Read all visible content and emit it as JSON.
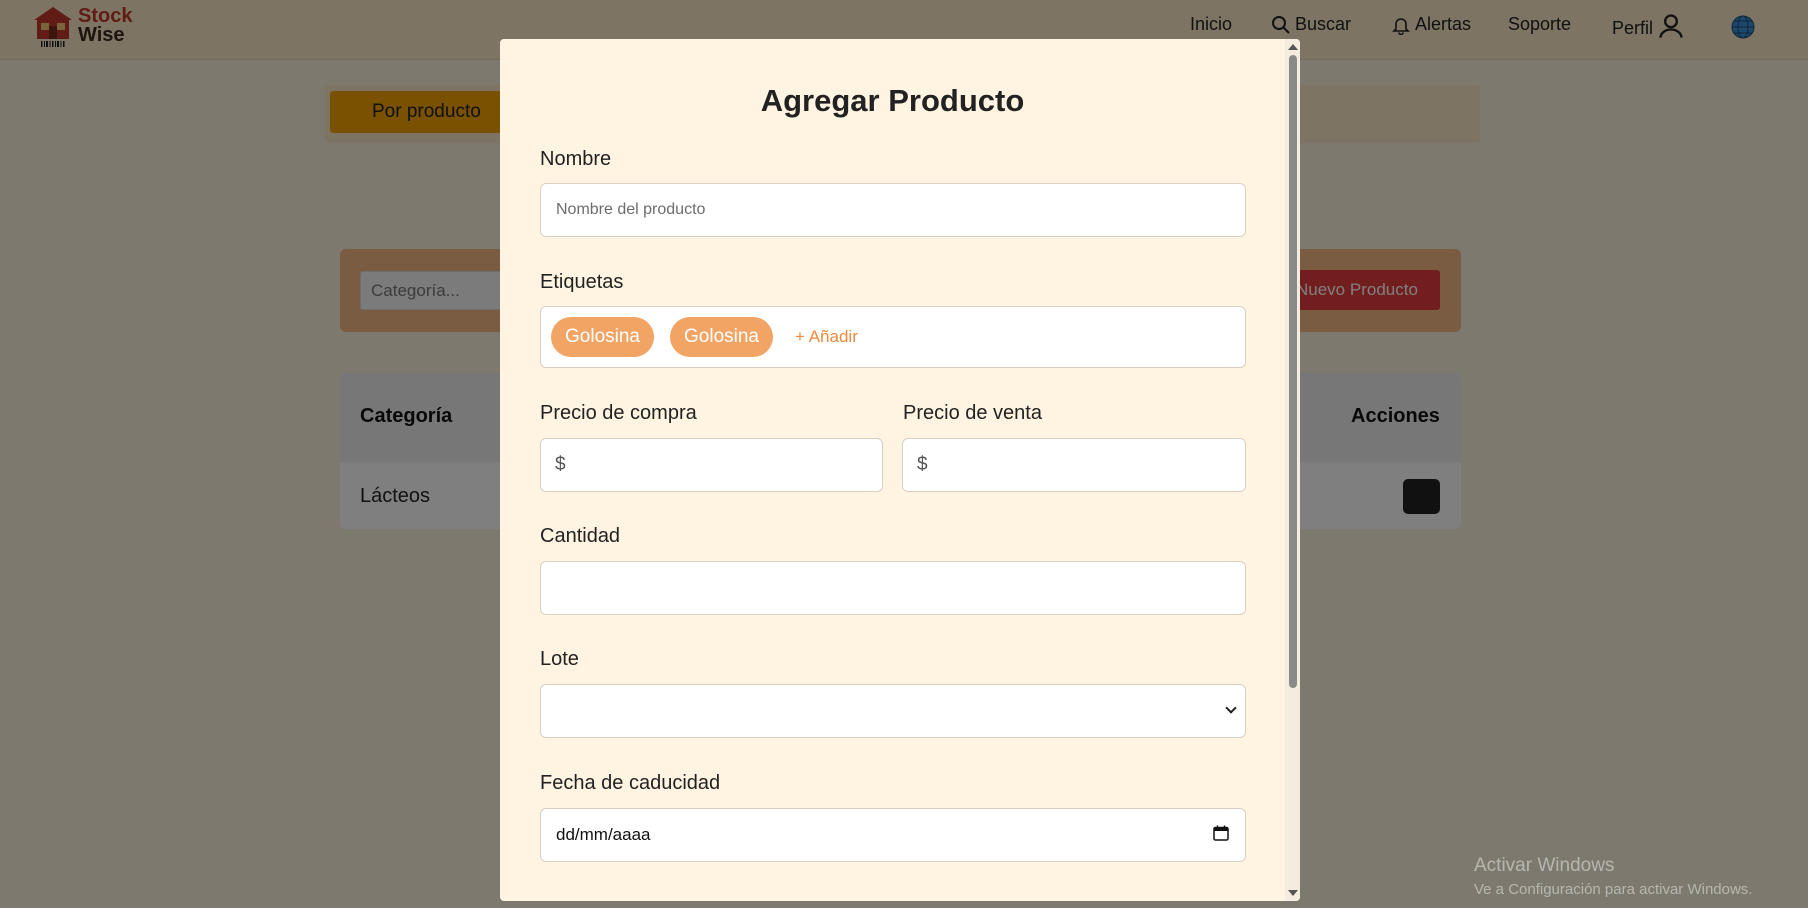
{
  "app": {
    "logo_line1": "Stock",
    "logo_line2": "Wise"
  },
  "nav": {
    "inicio": "Inicio",
    "buscar": "Buscar",
    "alertas": "Alertas",
    "soporte": "Soporte",
    "perfil": "Perfil"
  },
  "filters": {
    "active_tab": "Por producto"
  },
  "toolbar": {
    "category_placeholder": "Categoría...",
    "new_product_button": "Nuevo Producto"
  },
  "table": {
    "headers": {
      "categoria": "Categoría",
      "acciones": "Acciones"
    },
    "rows": [
      {
        "categoria": "Lácteos"
      }
    ]
  },
  "modal": {
    "title": "Agregar Producto",
    "nombre_label": "Nombre",
    "nombre_placeholder": "Nombre del producto",
    "etiquetas_label": "Etiquetas",
    "tags": [
      "Golosina",
      "Golosina"
    ],
    "add_tag": "+ Añadir",
    "precio_compra_label": "Precio de compra",
    "precio_venta_label": "Precio de venta",
    "currency_symbol": "$",
    "cantidad_label": "Cantidad",
    "lote_label": "Lote",
    "fecha_label": "Fecha de caducidad",
    "fecha_placeholder": "dd/mm/aaaa"
  },
  "os_watermark": {
    "title": "Activar Windows",
    "subtitle": "Ve a Configuración para activar Windows."
  },
  "colors": {
    "accent_orange": "#f2a465",
    "danger_red": "#e53d3d",
    "modal_bg": "#fff4e1"
  }
}
